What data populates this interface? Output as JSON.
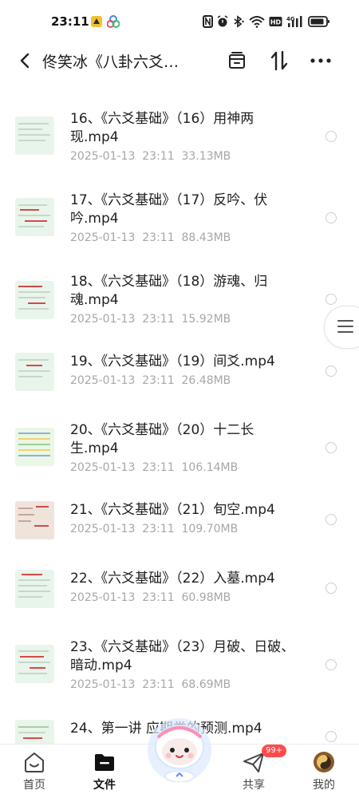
{
  "status_bar": {
    "time": "23:11",
    "icons": [
      "nfc-icon",
      "alarm-icon",
      "bluetooth-icon",
      "wifi-icon",
      "hd-icon",
      "signal-icon",
      "battery-icon"
    ],
    "signal_label": "4G"
  },
  "header": {
    "title": "佟笑冰《八卦六爻…",
    "icons": [
      "back-icon",
      "select-all-icon",
      "sort-icon",
      "more-icon"
    ]
  },
  "files": [
    {
      "name": "16、《六爻基础》（16）用神两现.mp4",
      "date": "2025-01-13  23:11",
      "size": "33.13MB"
    },
    {
      "name": "17、《六爻基础》（17）反吟、伏吟.mp4",
      "date": "2025-01-13  23:11",
      "size": "88.43MB"
    },
    {
      "name": "18、《六爻基础》（18）游魂、归魂.mp4",
      "date": "2025-01-13  23:11",
      "size": "15.92MB"
    },
    {
      "name": "19、《六爻基础》（19）间爻.mp4",
      "date": "2025-01-13  23:11",
      "size": "26.48MB"
    },
    {
      "name": "20、《六爻基础》（20）十二长生.mp4",
      "date": "2025-01-13  23:11",
      "size": "106.14MB"
    },
    {
      "name": "21、《六爻基础》（21）旬空.mp4",
      "date": "2025-01-13  23:11",
      "size": "109.70MB"
    },
    {
      "name": "22、《六爻基础》（22）入墓.mp4",
      "date": "2025-01-13  23:11",
      "size": "60.98MB"
    },
    {
      "name": "23、《六爻基础》（23）月破、日破、暗动.mp4",
      "date": "2025-01-13  23:11",
      "size": "68.69MB"
    },
    {
      "name": "24、第一讲 应期类的预测.mp4",
      "date": "",
      "size": ""
    }
  ],
  "tabbar": {
    "tabs": [
      {
        "label": "首页",
        "icon": "home-icon"
      },
      {
        "label": "文件",
        "icon": "folder-icon"
      },
      {
        "label": "共享",
        "icon": "share-icon"
      },
      {
        "label": "我的",
        "icon": "profile-icon"
      }
    ],
    "active": "文件",
    "share_badge": "99+"
  },
  "colors": {
    "accent": "#111111",
    "badge": "#ff4b4b",
    "meta_text": "#a7a7a7"
  }
}
